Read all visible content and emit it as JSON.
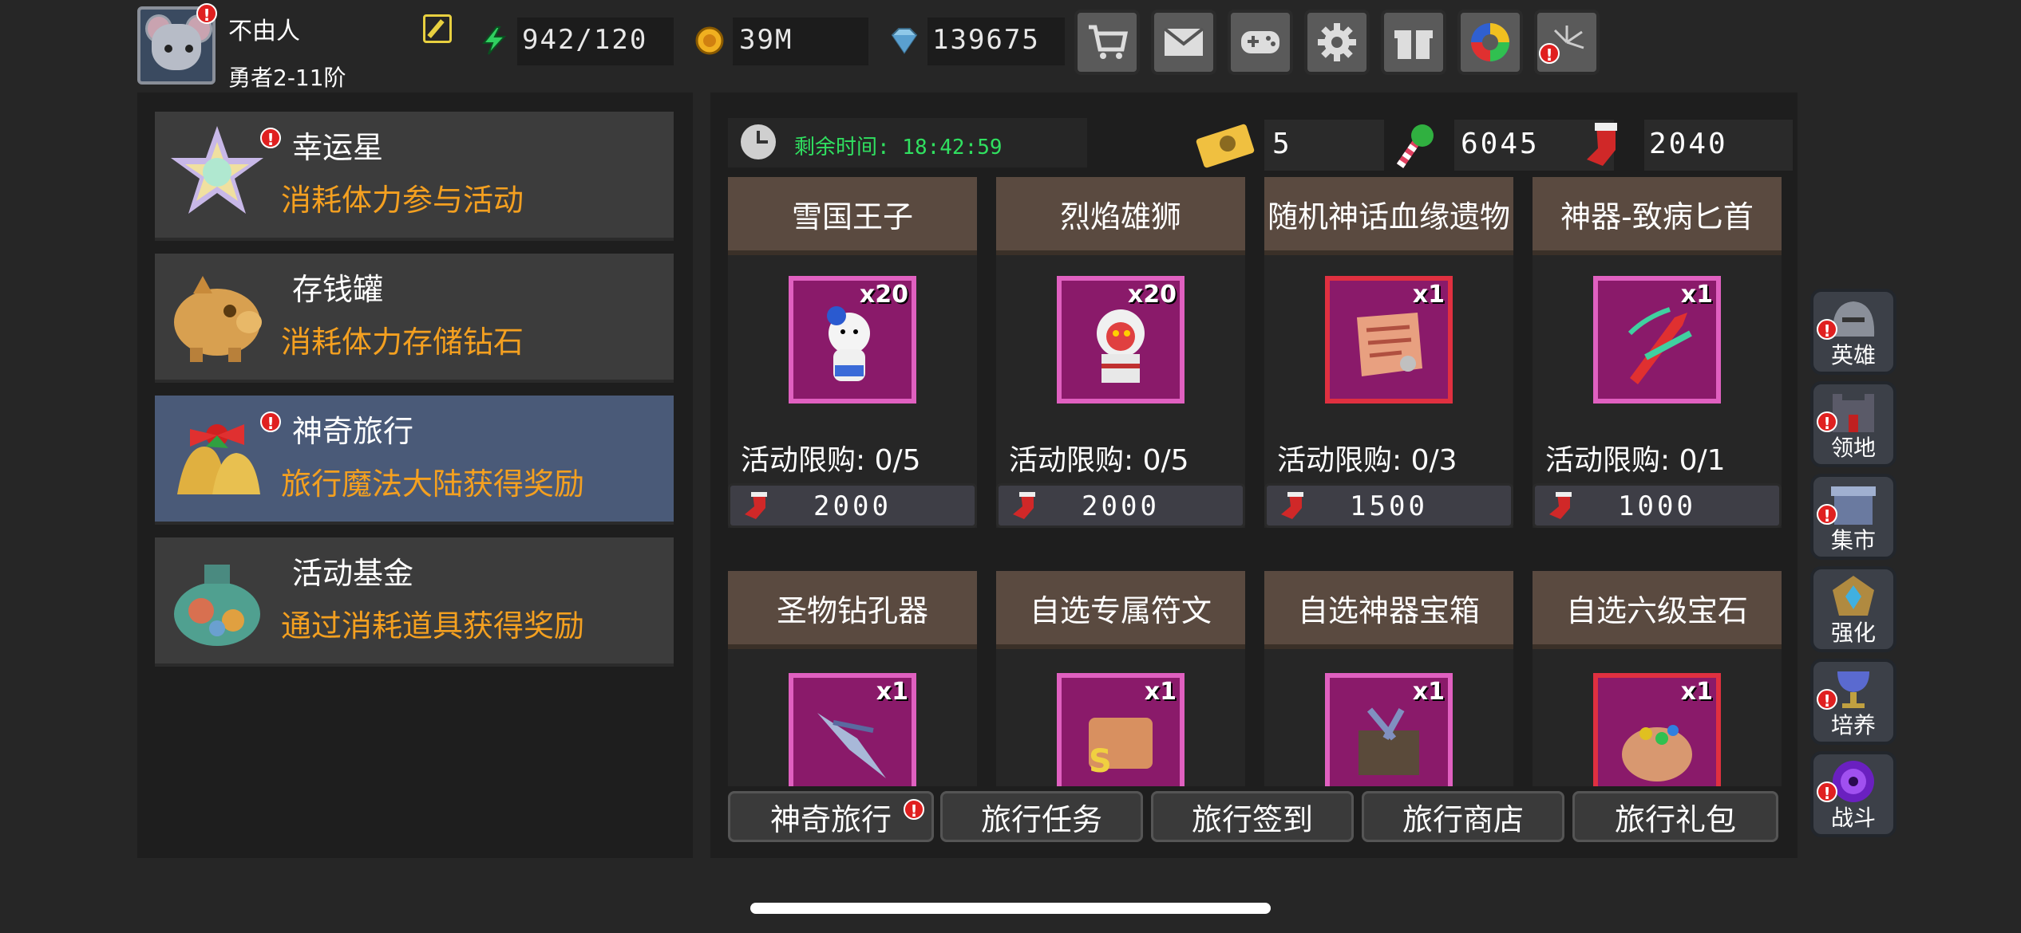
{
  "player": {
    "name": "不由人",
    "rank": "勇者2-11阶"
  },
  "resources": {
    "energy": "942/120",
    "gold": "39M",
    "gems": "139675"
  },
  "toolbar": [
    "cart-icon",
    "mail-icon",
    "gamepad-icon",
    "gear-icon",
    "gift-icon",
    "color-wheel-icon",
    "firework-icon"
  ],
  "activities": [
    {
      "title": "幸运星",
      "desc": "消耗体力参与活动",
      "alert": true
    },
    {
      "title": "存钱罐",
      "desc": "消耗体力存储钻石",
      "alert": false
    },
    {
      "title": "神奇旅行",
      "desc": "旅行魔法大陆获得奖励",
      "alert": true
    },
    {
      "title": "活动基金",
      "desc": "通过消耗道具获得奖励",
      "alert": false
    }
  ],
  "shop": {
    "timer": "剩余时间: 18:42:59",
    "currencies": {
      "ticket": "5",
      "candy": "6045",
      "sock": "2040"
    },
    "items": [
      {
        "name": "雪国王子",
        "count": "x20",
        "limit": "活动限购: 0/5",
        "price": "2000"
      },
      {
        "name": "烈焰雄狮",
        "count": "x20",
        "limit": "活动限购: 0/5",
        "price": "2000"
      },
      {
        "name": "随机神话血缘遗物",
        "count": "x1",
        "limit": "活动限购: 0/3",
        "price": "1500"
      },
      {
        "name": "神器-致病匕首",
        "count": "x1",
        "limit": "活动限购: 0/1",
        "price": "1000"
      },
      {
        "name": "圣物钻孔器",
        "count": "x1"
      },
      {
        "name": "自选专属符文",
        "count": "x1"
      },
      {
        "name": "自选神器宝箱",
        "count": "x1"
      },
      {
        "name": "自选六级宝石",
        "count": "x1"
      }
    ],
    "tabs": [
      "神奇旅行",
      "旅行任务",
      "旅行签到",
      "旅行商店",
      "旅行礼包"
    ]
  },
  "side_nav": [
    {
      "label": "英雄",
      "alert": true
    },
    {
      "label": "领地",
      "alert": true
    },
    {
      "label": "集市",
      "alert": true
    },
    {
      "label": "强化",
      "alert": false
    },
    {
      "label": "培养",
      "alert": true
    },
    {
      "label": "战斗",
      "alert": true
    }
  ],
  "colors": {
    "accent_orange": "#f4a020",
    "timer_green": "#30e060",
    "selected_row": "#4a5a78",
    "alert_red": "#e02020"
  }
}
